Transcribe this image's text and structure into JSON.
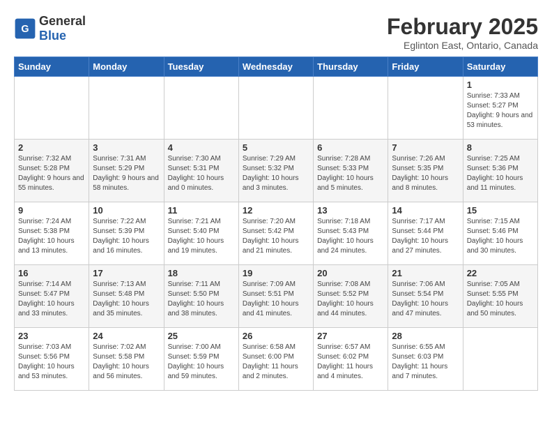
{
  "header": {
    "logo_general": "General",
    "logo_blue": "Blue",
    "title": "February 2025",
    "subtitle": "Eglinton East, Ontario, Canada"
  },
  "weekdays": [
    "Sunday",
    "Monday",
    "Tuesday",
    "Wednesday",
    "Thursday",
    "Friday",
    "Saturday"
  ],
  "weeks": [
    [
      {
        "day": "",
        "info": ""
      },
      {
        "day": "",
        "info": ""
      },
      {
        "day": "",
        "info": ""
      },
      {
        "day": "",
        "info": ""
      },
      {
        "day": "",
        "info": ""
      },
      {
        "day": "",
        "info": ""
      },
      {
        "day": "1",
        "info": "Sunrise: 7:33 AM\nSunset: 5:27 PM\nDaylight: 9 hours and 53 minutes."
      }
    ],
    [
      {
        "day": "2",
        "info": "Sunrise: 7:32 AM\nSunset: 5:28 PM\nDaylight: 9 hours and 55 minutes."
      },
      {
        "day": "3",
        "info": "Sunrise: 7:31 AM\nSunset: 5:29 PM\nDaylight: 9 hours and 58 minutes."
      },
      {
        "day": "4",
        "info": "Sunrise: 7:30 AM\nSunset: 5:31 PM\nDaylight: 10 hours and 0 minutes."
      },
      {
        "day": "5",
        "info": "Sunrise: 7:29 AM\nSunset: 5:32 PM\nDaylight: 10 hours and 3 minutes."
      },
      {
        "day": "6",
        "info": "Sunrise: 7:28 AM\nSunset: 5:33 PM\nDaylight: 10 hours and 5 minutes."
      },
      {
        "day": "7",
        "info": "Sunrise: 7:26 AM\nSunset: 5:35 PM\nDaylight: 10 hours and 8 minutes."
      },
      {
        "day": "8",
        "info": "Sunrise: 7:25 AM\nSunset: 5:36 PM\nDaylight: 10 hours and 11 minutes."
      }
    ],
    [
      {
        "day": "9",
        "info": "Sunrise: 7:24 AM\nSunset: 5:38 PM\nDaylight: 10 hours and 13 minutes."
      },
      {
        "day": "10",
        "info": "Sunrise: 7:22 AM\nSunset: 5:39 PM\nDaylight: 10 hours and 16 minutes."
      },
      {
        "day": "11",
        "info": "Sunrise: 7:21 AM\nSunset: 5:40 PM\nDaylight: 10 hours and 19 minutes."
      },
      {
        "day": "12",
        "info": "Sunrise: 7:20 AM\nSunset: 5:42 PM\nDaylight: 10 hours and 21 minutes."
      },
      {
        "day": "13",
        "info": "Sunrise: 7:18 AM\nSunset: 5:43 PM\nDaylight: 10 hours and 24 minutes."
      },
      {
        "day": "14",
        "info": "Sunrise: 7:17 AM\nSunset: 5:44 PM\nDaylight: 10 hours and 27 minutes."
      },
      {
        "day": "15",
        "info": "Sunrise: 7:15 AM\nSunset: 5:46 PM\nDaylight: 10 hours and 30 minutes."
      }
    ],
    [
      {
        "day": "16",
        "info": "Sunrise: 7:14 AM\nSunset: 5:47 PM\nDaylight: 10 hours and 33 minutes."
      },
      {
        "day": "17",
        "info": "Sunrise: 7:13 AM\nSunset: 5:48 PM\nDaylight: 10 hours and 35 minutes."
      },
      {
        "day": "18",
        "info": "Sunrise: 7:11 AM\nSunset: 5:50 PM\nDaylight: 10 hours and 38 minutes."
      },
      {
        "day": "19",
        "info": "Sunrise: 7:09 AM\nSunset: 5:51 PM\nDaylight: 10 hours and 41 minutes."
      },
      {
        "day": "20",
        "info": "Sunrise: 7:08 AM\nSunset: 5:52 PM\nDaylight: 10 hours and 44 minutes."
      },
      {
        "day": "21",
        "info": "Sunrise: 7:06 AM\nSunset: 5:54 PM\nDaylight: 10 hours and 47 minutes."
      },
      {
        "day": "22",
        "info": "Sunrise: 7:05 AM\nSunset: 5:55 PM\nDaylight: 10 hours and 50 minutes."
      }
    ],
    [
      {
        "day": "23",
        "info": "Sunrise: 7:03 AM\nSunset: 5:56 PM\nDaylight: 10 hours and 53 minutes."
      },
      {
        "day": "24",
        "info": "Sunrise: 7:02 AM\nSunset: 5:58 PM\nDaylight: 10 hours and 56 minutes."
      },
      {
        "day": "25",
        "info": "Sunrise: 7:00 AM\nSunset: 5:59 PM\nDaylight: 10 hours and 59 minutes."
      },
      {
        "day": "26",
        "info": "Sunrise: 6:58 AM\nSunset: 6:00 PM\nDaylight: 11 hours and 2 minutes."
      },
      {
        "day": "27",
        "info": "Sunrise: 6:57 AM\nSunset: 6:02 PM\nDaylight: 11 hours and 4 minutes."
      },
      {
        "day": "28",
        "info": "Sunrise: 6:55 AM\nSunset: 6:03 PM\nDaylight: 11 hours and 7 minutes."
      },
      {
        "day": "",
        "info": ""
      }
    ]
  ]
}
